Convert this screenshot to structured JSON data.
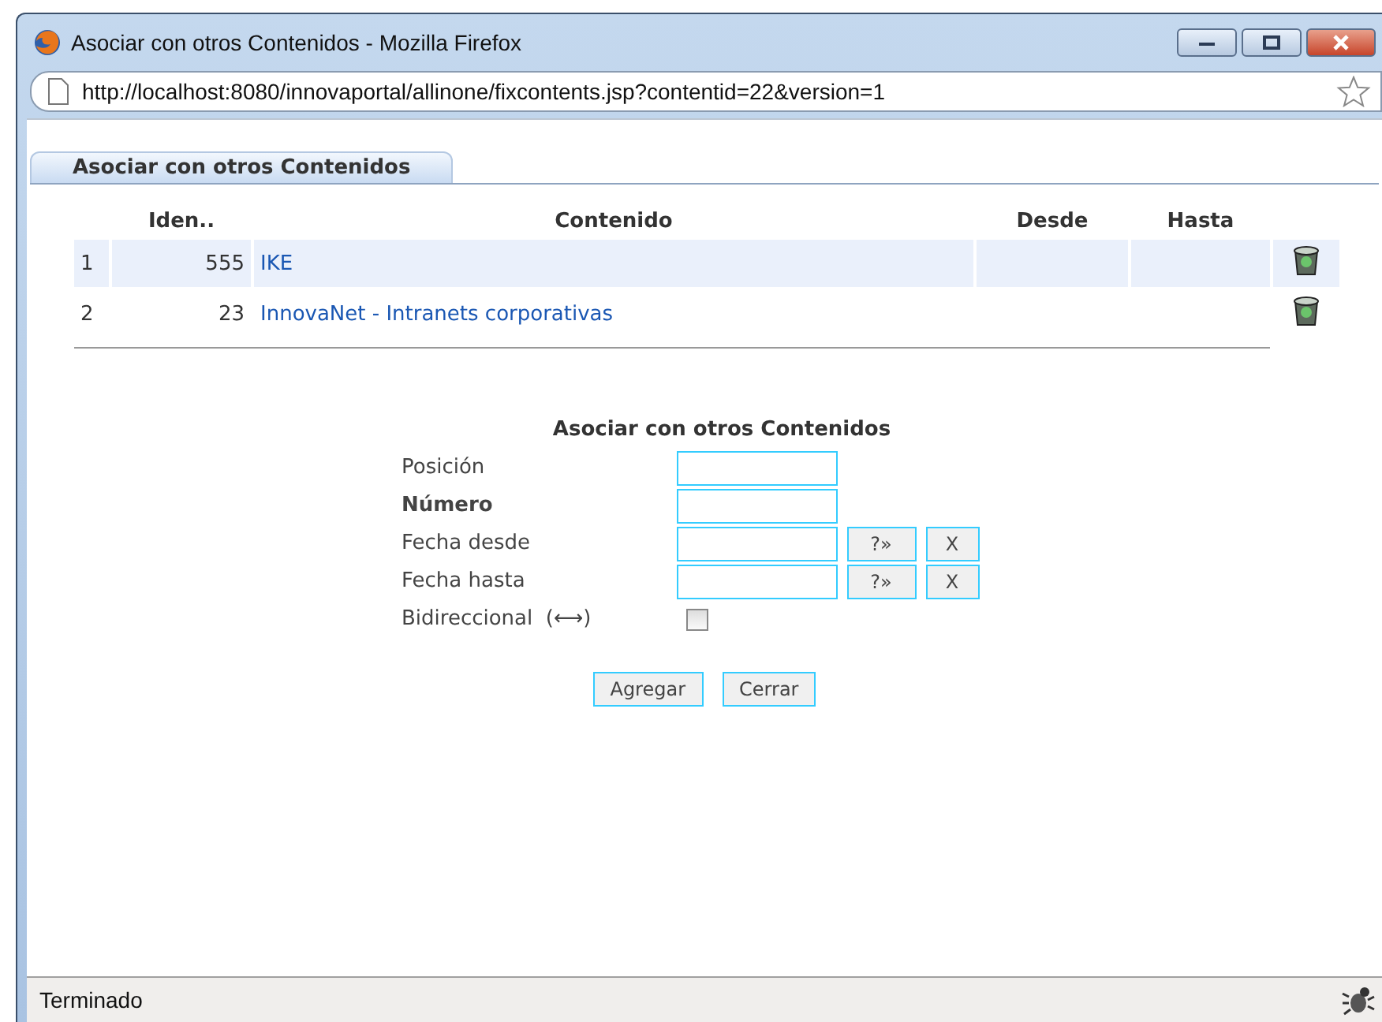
{
  "window": {
    "title": "Asociar con otros Contenidos - Mozilla Firefox",
    "url": "http://localhost:8080/innovaportal/allinone/fixcontents.jsp?contentid=22&version=1"
  },
  "tabs": [
    {
      "label": "Asociar con otros Contenidos",
      "selected": true
    }
  ],
  "table": {
    "columns": [
      "Iden..",
      "Contenido",
      "Desde",
      "Hasta"
    ],
    "rows": [
      {
        "index": "1",
        "id": "555",
        "content": "IKE",
        "highlighted": true
      },
      {
        "index": "2",
        "id": "23",
        "content": "InnovaNet - Intranets corporativas",
        "highlighted": false
      }
    ]
  },
  "form": {
    "title": "Asociar con otros Contenidos",
    "fields": [
      {
        "kind": "text",
        "label": "Posición",
        "bold": false
      },
      {
        "kind": "text",
        "label": "Número",
        "bold": true
      },
      {
        "kind": "date",
        "label": "Fecha desde",
        "bold": false,
        "picker": "?»",
        "clear": "X"
      },
      {
        "kind": "date",
        "label": "Fecha hasta",
        "bold": false,
        "picker": "?»",
        "clear": "X"
      },
      {
        "kind": "checkbox",
        "label": "Bidireccional  (⟷)",
        "bold": false,
        "checked": false
      }
    ],
    "buttons": [
      "Agregar",
      "Cerrar"
    ]
  },
  "status_bar": {
    "text": "Terminado"
  }
}
